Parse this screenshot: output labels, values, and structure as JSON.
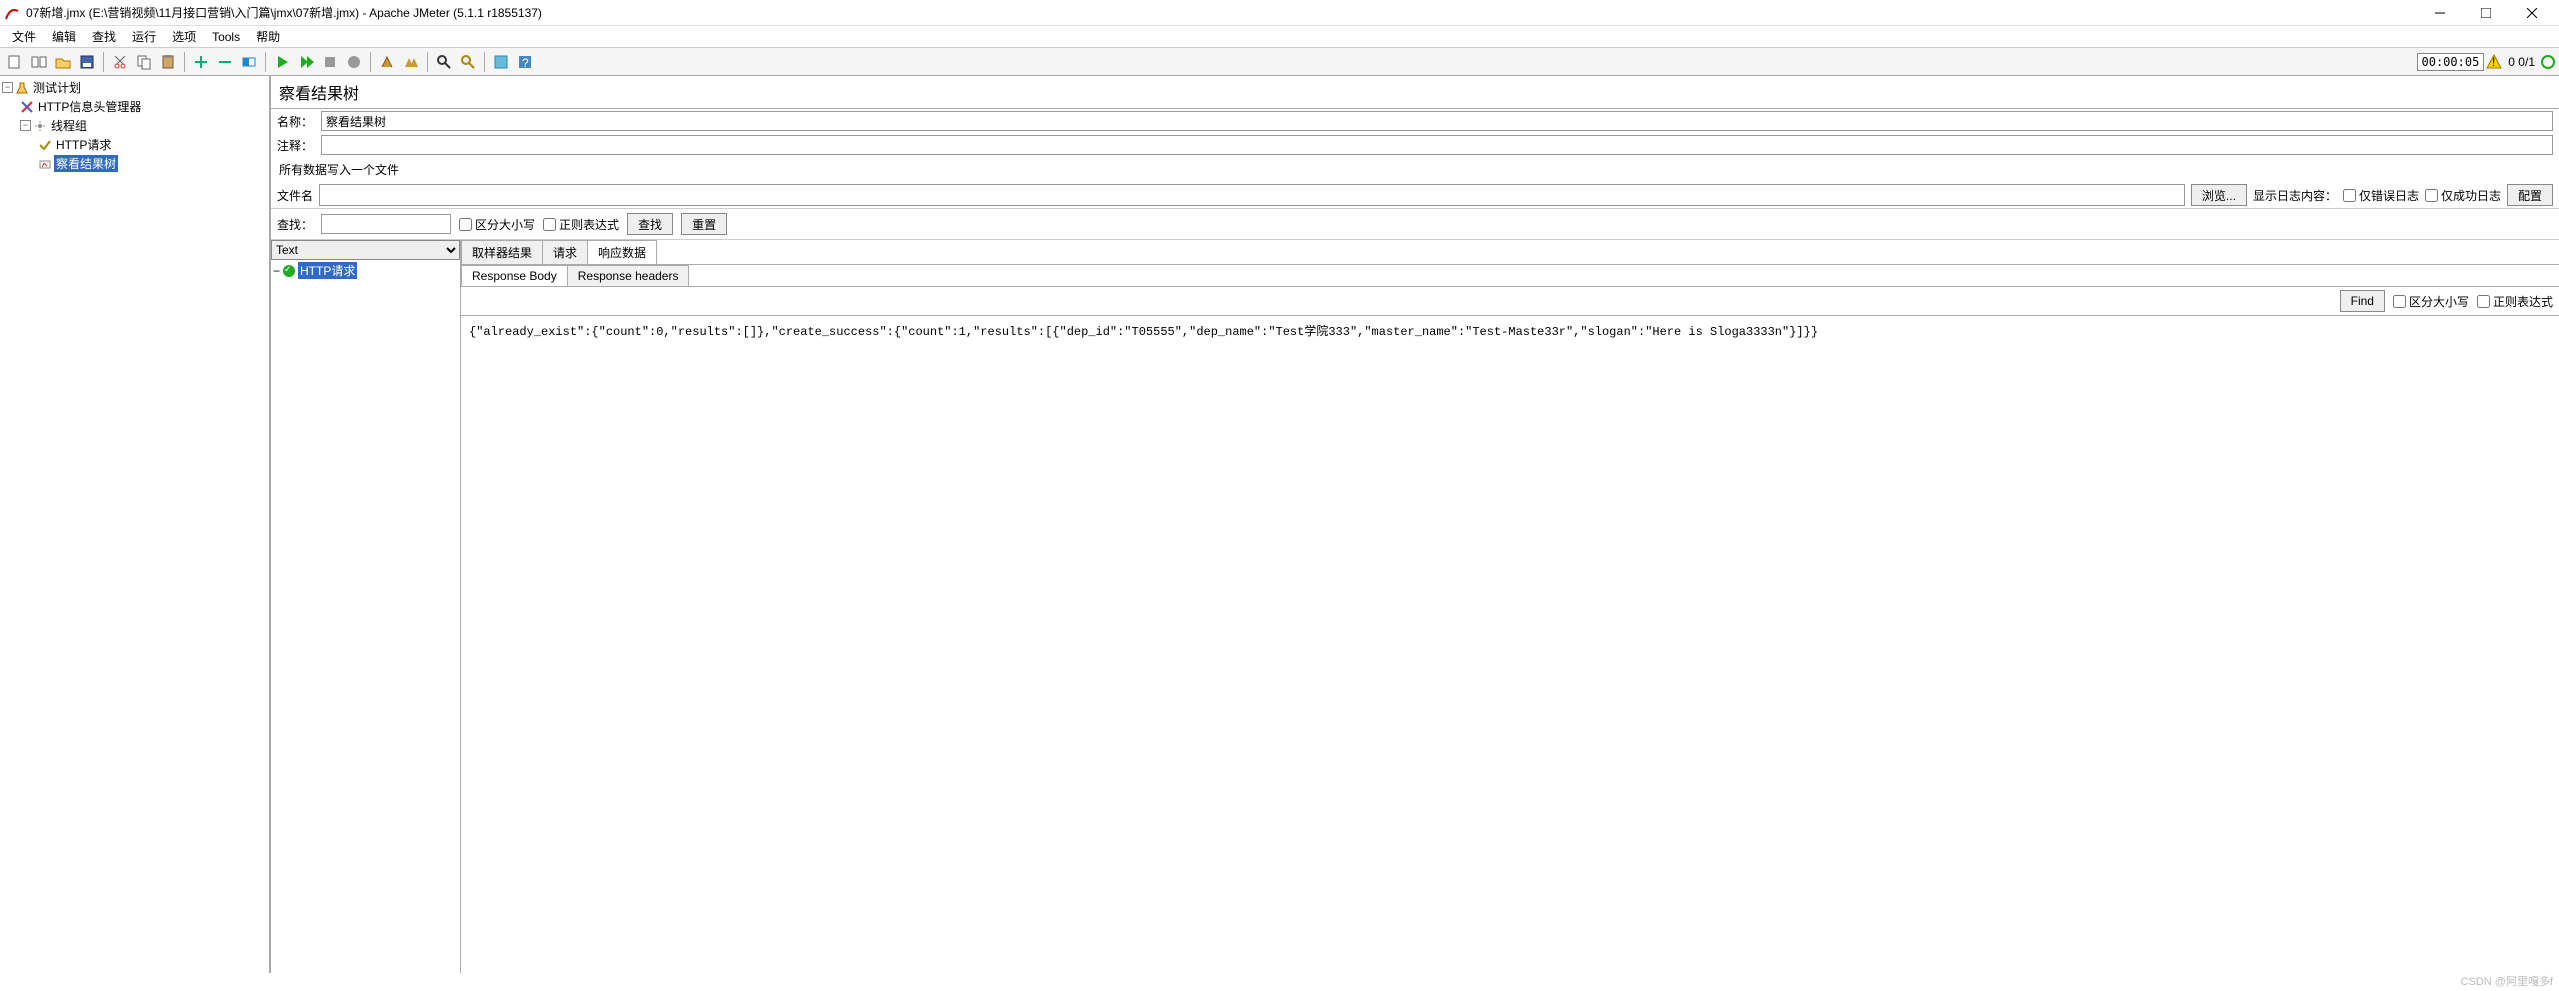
{
  "window": {
    "title": "07新增.jmx (E:\\营销视频\\11月接口营销\\入门篇\\jmx\\07新增.jmx) - Apache JMeter (5.1.1 r1855137)"
  },
  "menu": {
    "file": "文件",
    "edit": "编辑",
    "search": "查找",
    "run": "运行",
    "options": "选项",
    "tools": "Tools",
    "help": "帮助"
  },
  "toolbar": {
    "timer": "00:00:05",
    "threads": "0 0/1"
  },
  "tree": {
    "n0": "测试计划",
    "n1": "HTTP信息头管理器",
    "n2": "线程组",
    "n3": "HTTP请求",
    "n4": "察看结果树"
  },
  "panel": {
    "title": "察看结果树",
    "name_label": "名称：",
    "name_value": "察看结果树",
    "comment_label": "注释：",
    "comment_value": "",
    "write_all": "所有数据写入一个文件",
    "filename_label": "文件名",
    "filename_value": "",
    "browse": "浏览...",
    "log_show": "显示日志内容：",
    "only_error": "仅错误日志",
    "only_success": "仅成功日志",
    "config": "配置"
  },
  "searchbar": {
    "label": "查找：",
    "value": "",
    "case": "区分大小写",
    "regex": "正则表达式",
    "find": "查找",
    "reset": "重置"
  },
  "results": {
    "renderer": "Text",
    "sample_label": "HTTP请求",
    "tab_sampler": "取样器结果",
    "tab_request": "请求",
    "tab_response": "响应数据",
    "tab_body": "Response Body",
    "tab_headers": "Response headers",
    "find": "Find",
    "case": "区分大小写",
    "regex": "正则表达式",
    "body": "{\"already_exist\":{\"count\":0,\"results\":[]},\"create_success\":{\"count\":1,\"results\":[{\"dep_id\":\"T05555\",\"dep_name\":\"Test学院333\",\"master_name\":\"Test-Maste33r\",\"slogan\":\"Here is Sloga3333n\"}]}}"
  },
  "watermark": "CSDN @阿里嘎多f"
}
